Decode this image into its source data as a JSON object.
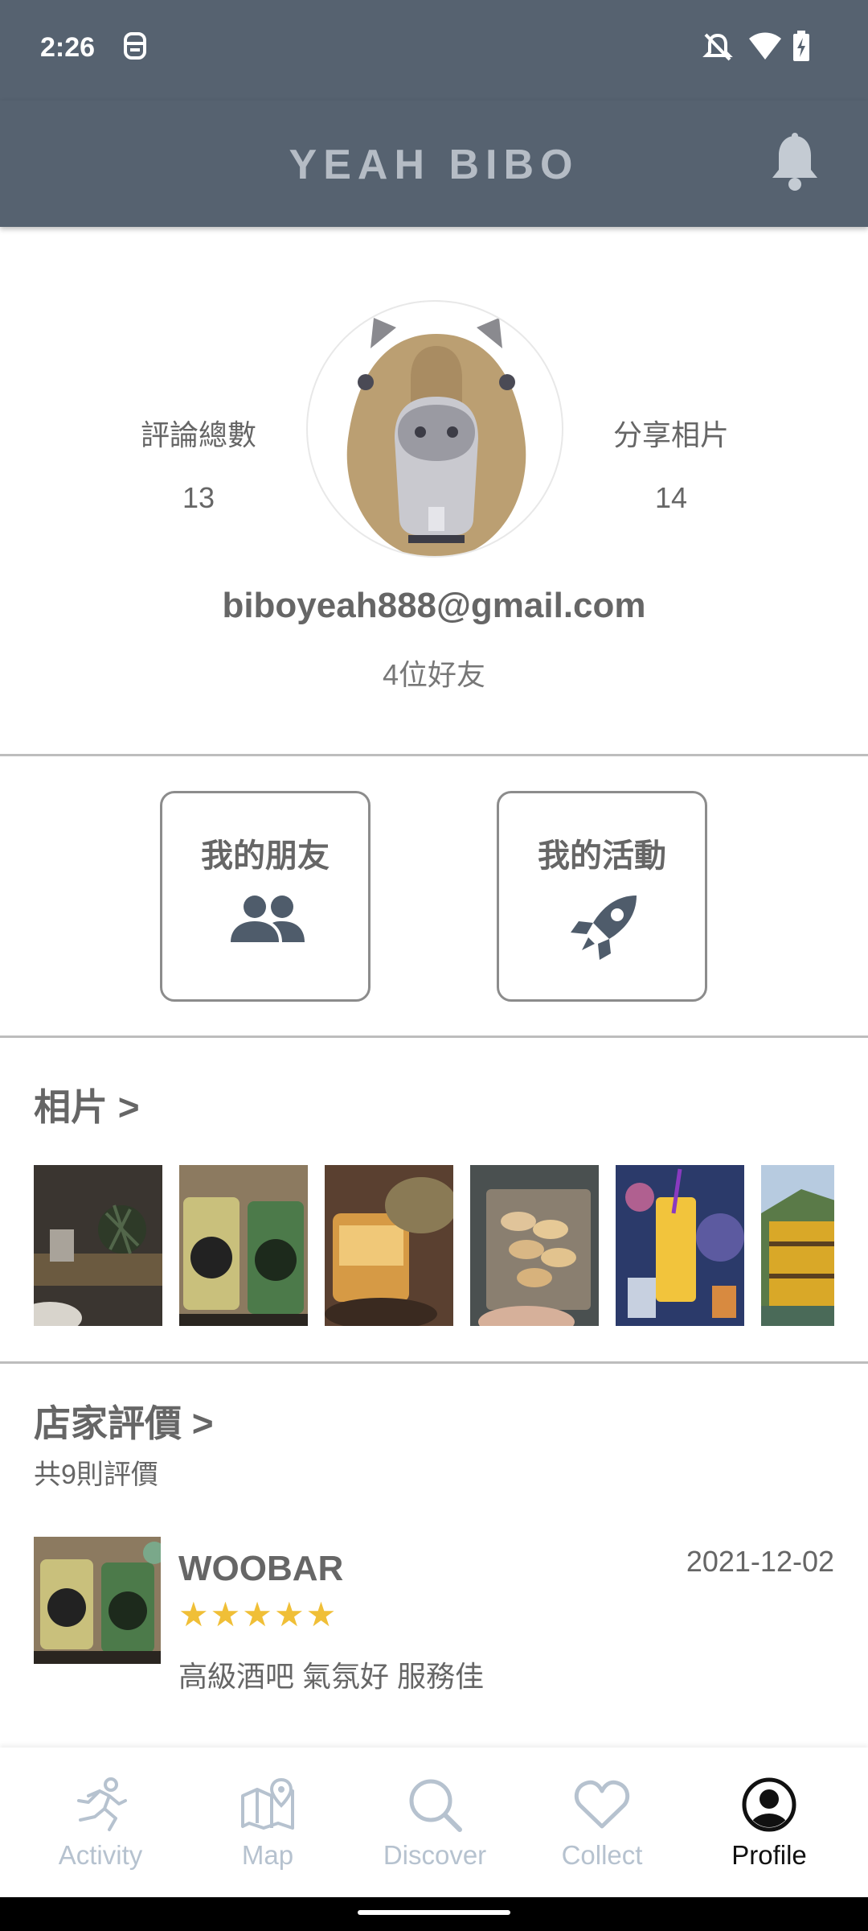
{
  "status_bar": {
    "time": "2:26"
  },
  "app_bar": {
    "title": "YEAH BIBO"
  },
  "profile": {
    "reviews_label": "評論總數",
    "reviews_count": "13",
    "photos_label": "分享相片",
    "photos_count": "14",
    "email": "biboyeah888@gmail.com",
    "friends_count": "4位好友"
  },
  "tiles": {
    "friends_label": "我的朋友",
    "activities_label": "我的活動"
  },
  "photos_section": {
    "title": "相片 >"
  },
  "reviews_section": {
    "title": "店家評價 >",
    "subtitle": "共9則評價",
    "items": [
      {
        "name": "WOOBAR",
        "date": "2021-12-02",
        "stars": "★★★★★",
        "text": "高級酒吧 氣氛好 服務佳"
      }
    ]
  },
  "bottom_nav": {
    "items": [
      {
        "label": "Activity",
        "icon": "running-icon"
      },
      {
        "label": "Map",
        "icon": "map-icon"
      },
      {
        "label": "Discover",
        "icon": "search-icon"
      },
      {
        "label": "Collect",
        "icon": "heart-icon"
      },
      {
        "label": "Profile",
        "icon": "profile-icon"
      }
    ],
    "active": "Profile"
  },
  "colors": {
    "app_bar": "#566270",
    "star": "#f0bf37",
    "nav_inactive": "#b6c2cf",
    "nav_active": "#111111"
  }
}
